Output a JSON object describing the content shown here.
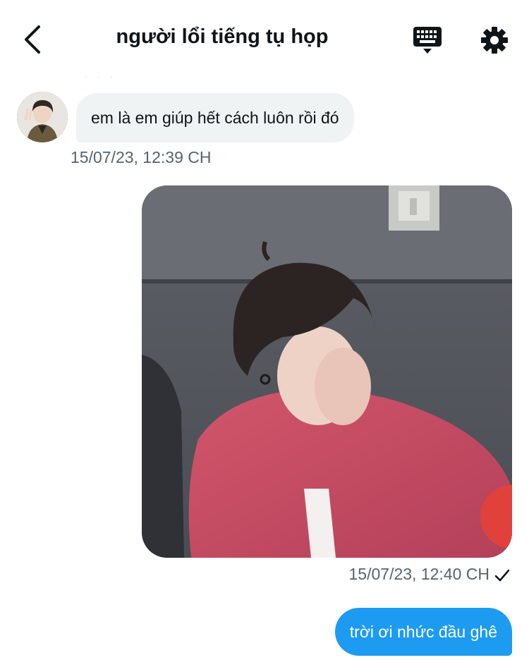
{
  "header": {
    "title": "người lổi tiếng tụ họp",
    "back_icon": "chevron-left-icon",
    "keyboard_icon": "keyboard-icon",
    "settings_icon": "gear-icon"
  },
  "messages": [
    {
      "direction": "incoming",
      "type": "text",
      "text": "em là em giúp hết cách luôn rồi đó",
      "timestamp": "15/07/23, 12:39 CH"
    },
    {
      "direction": "outgoing",
      "type": "image",
      "timestamp": "15/07/23, 12:40 CH",
      "read_receipt_icon": "checkmark-icon"
    },
    {
      "direction": "outgoing",
      "type": "text",
      "text": "trời ơi nhức đầu ghê"
    }
  ],
  "colors": {
    "outgoing_bubble": "#1d9bf0",
    "incoming_bubble": "#eff3f4",
    "timestamp": "#536471"
  }
}
